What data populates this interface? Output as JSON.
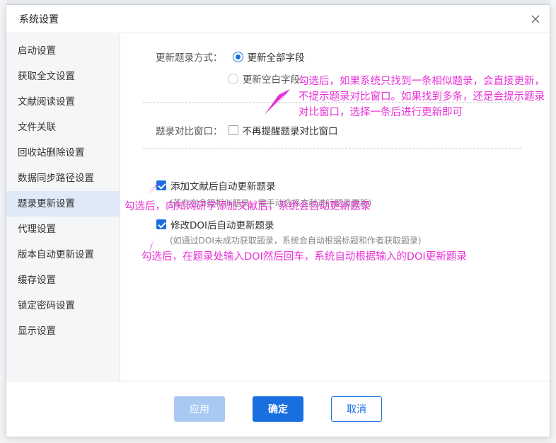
{
  "dialog": {
    "title": "系统设置"
  },
  "sidebar": {
    "items": [
      {
        "label": "启动设置"
      },
      {
        "label": "获取全文设置"
      },
      {
        "label": "文献阅读设置"
      },
      {
        "label": "文件关联"
      },
      {
        "label": "回收站删除设置"
      },
      {
        "label": "数据同步路径设置"
      },
      {
        "label": "题录更新设置"
      },
      {
        "label": "代理设置"
      },
      {
        "label": "版本自动更新设置"
      },
      {
        "label": "缓存设置"
      },
      {
        "label": "锁定密码设置"
      },
      {
        "label": "显示设置"
      }
    ],
    "active_index": 6
  },
  "settings": {
    "update_mode_label": "更新题录方式：",
    "option_all_fields": "更新全部字段",
    "option_empty_fields": "更新空白字段",
    "compare_window_label": "题录对比窗口：",
    "compare_window_checkbox": "不再提醒题录对比窗口",
    "auto_update_after_add": "添加文献后自动更新题录",
    "auto_update_after_add_hint": "(若存在多篇相似题录，需手动选择文献进行题录更新)",
    "auto_update_after_doi": "修改DOI后自动更新题录",
    "auto_update_after_doi_hint": "(如通过DOI未成功获取题录，系统会自动根据标题和作者获取题录)"
  },
  "footer": {
    "apply": "应用",
    "ok": "确定",
    "cancel": "取消"
  },
  "annotations": {
    "note1": "勾选后，如果系统只找到一条相似题录，会直接更新，不提示题录对比窗口。如果找到多条，还是会提示题录对比窗口，选择一条后进行更新即可",
    "note2": "勾选后，向知网研学添加文献后，系统会自动更新题录",
    "note3": "勾选后，在题录处输入DOI然后回车，系统自动根据输入的DOI更新题录"
  },
  "colors": {
    "accent": "#1a6fe0",
    "annotation": "#e82fd6",
    "active_item_bg": "#dfe9f7"
  }
}
